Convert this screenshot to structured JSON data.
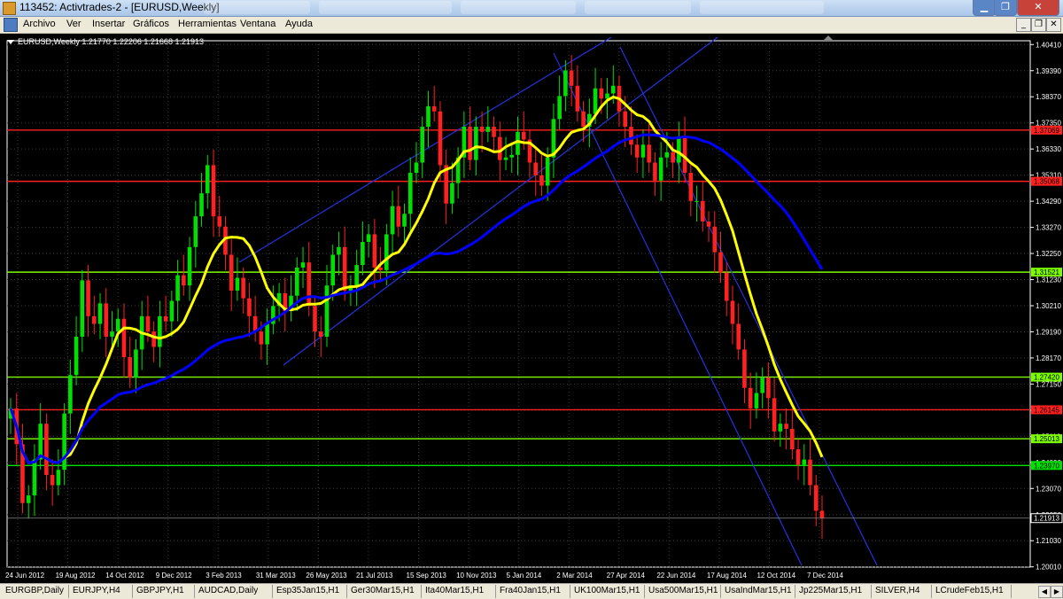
{
  "window": {
    "title": "113452: Activtrades-2 - [EURUSD,Weekly]"
  },
  "menu": [
    "Archivo",
    "Ver",
    "Insertar",
    "Gráficos",
    "Herramientas",
    "Ventana",
    "Ayuda"
  ],
  "chart": {
    "header": "EURUSD,Weekly  1.21770 1.22206 1.21668 1.21913",
    "symbol": "EURUSD",
    "timeframe": "Weekly",
    "ohlc": [
      1.2177,
      1.22206,
      1.21668,
      1.21913
    ],
    "current_price": "1.21913"
  },
  "chart_data": {
    "type": "candlestick",
    "y_min": 1.2,
    "y_max": 1.4042,
    "y_ticks": [
      "1.40410",
      "1.39390",
      "1.38370",
      "1.37350",
      "1.36330",
      "1.35310",
      "1.34290",
      "1.33270",
      "1.32250",
      "1.31230",
      "1.30210",
      "1.29190",
      "1.28170",
      "1.27150",
      "1.26130",
      "1.25110",
      "1.24090",
      "1.23070",
      "1.22050",
      "1.21030",
      "1.20010"
    ],
    "x_labels": [
      "24 Jun 2012",
      "19 Aug 2012",
      "14 Oct 2012",
      "9 Dec 2012",
      "3 Feb 2013",
      "31 Mar 2013",
      "26 May 2013",
      "21 Jul 2013",
      "15 Sep 2013",
      "10 Nov 2013",
      "5 Jan 2014",
      "2 Mar 2014",
      "27 Apr 2014",
      "22 Jun 2014",
      "17 Aug 2014",
      "12 Oct 2014",
      "7 Dec 2014"
    ],
    "horizontal_levels": [
      {
        "label": "1.37069",
        "value": 1.37069,
        "color": "#ff2020"
      },
      {
        "label": "1.35068",
        "value": 1.35068,
        "color": "#ff2020"
      },
      {
        "label": "1.31521",
        "value": 1.31521,
        "color": "#7cfc00"
      },
      {
        "label": "1.27420",
        "value": 1.2742,
        "color": "#7cfc00"
      },
      {
        "label": "1.26145",
        "value": 1.26145,
        "color": "#ff2020"
      },
      {
        "label": "1.25013",
        "value": 1.25013,
        "color": "#7cfc00"
      },
      {
        "label": "1.23970",
        "value": 1.2397,
        "color": "#00e000"
      }
    ],
    "up_color": "#00e000",
    "down_color": "#ff2020",
    "ma_fast_color": "#ffff00",
    "ma_slow_color": "#0000ff",
    "channel_color": "#2233dd",
    "closes": [
      1.262,
      1.248,
      1.225,
      1.228,
      1.242,
      1.256,
      1.236,
      1.232,
      1.238,
      1.26,
      1.275,
      1.29,
      1.312,
      1.298,
      1.295,
      1.303,
      1.29,
      1.292,
      1.297,
      1.282,
      1.274,
      1.285,
      1.298,
      1.292,
      1.286,
      1.298,
      1.296,
      1.304,
      1.314,
      1.31,
      1.325,
      1.337,
      1.346,
      1.357,
      1.337,
      1.333,
      1.322,
      1.308,
      1.313,
      1.305,
      1.298,
      1.292,
      1.287,
      1.295,
      1.302,
      1.307,
      1.3,
      1.306,
      1.317,
      1.319,
      1.302,
      1.292,
      1.29,
      1.31,
      1.322,
      1.325,
      1.308,
      1.31,
      1.318,
      1.327,
      1.33,
      1.317,
      1.316,
      1.33,
      1.341,
      1.333,
      1.338,
      1.354,
      1.358,
      1.372,
      1.38,
      1.378,
      1.357,
      1.342,
      1.35,
      1.36,
      1.372,
      1.359,
      1.372,
      1.37,
      1.372,
      1.368,
      1.359,
      1.36,
      1.361,
      1.37,
      1.367,
      1.358,
      1.353,
      1.349,
      1.36,
      1.375,
      1.384,
      1.394,
      1.388,
      1.378,
      1.372,
      1.377,
      1.387,
      1.383,
      1.385,
      1.388,
      1.378,
      1.372,
      1.365,
      1.36,
      1.365,
      1.358,
      1.351,
      1.36,
      1.362,
      1.358,
      1.368,
      1.354,
      1.343,
      1.343,
      1.335,
      1.333,
      1.323,
      1.315,
      1.304,
      1.295,
      1.285,
      1.27,
      1.262,
      1.268,
      1.274,
      1.266,
      1.253,
      1.256,
      1.254,
      1.246,
      1.24,
      1.242,
      1.232,
      1.222,
      1.219
    ]
  },
  "tabs": [
    "EURGBP,Daily",
    "EURJPY,H4",
    "GBPJPY,H1",
    "AUDCAD,Daily",
    "Esp35Jan15,H1",
    "Ger30Mar15,H1",
    "Ita40Mar15,H1",
    "Fra40Jan15,H1",
    "UK100Mar15,H1",
    "Usa500Mar15,H1",
    "UsaIndMar15,H1",
    "Jp225Mar15,H1",
    "SILVER,H4",
    "LCrudeFeb15,H1"
  ]
}
